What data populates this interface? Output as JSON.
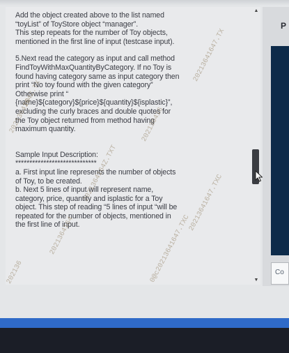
{
  "content": {
    "lines": [
      "Add the object created above to the list named",
      "“toyList” of ToyStore object “manager”.",
      "This step repeats for the number of Toy objects,",
      "mentioned in the first line of input (testcase input).",
      "5.Next read the category as input and call method",
      "FindToyWithMaxQuantityByCategory. If no Toy is",
      "found having category same as input category then",
      "print “No toy found with the given category”",
      "Otherwise print “",
      "{name}${category}${price}${quantity}${isplastic}”,",
      "excluding the curly braces and double quotes for",
      "the Toy object returned from method having",
      "maximum quantity.",
      "Sample Input Description:",
      "*****************************",
      "a. First input line represents the number of objects",
      "of Toy, to be created.",
      "b. Next 5 lines of input will represent name,",
      "category, price, quantity and isplastic for a Toy",
      "object. This step of reading “5 lines of input “will be",
      "repeated for the number of objects, mentioned in",
      "the first line of input."
    ]
  },
  "watermarks": [
    "2021364164Z.TX",
    "20213641647.TX",
    "2021364164Z.TXT",
    "20213641647.TXC",
    "202136416",
    "0@c20213641647.TXC",
    "202136",
    "2021364164",
    "20"
  ],
  "right_panel": {
    "label": "P",
    "input_value": "Co"
  },
  "colors": {
    "text": "#3a3c44",
    "pane_background": "#e9eaec",
    "dark_column": "#0d2b4a",
    "taskbar": "#2f6ac8",
    "scroll_thumb": "#3b3d42"
  },
  "icons": {
    "scroll_up": "triangle-up",
    "scroll_down": "triangle-down",
    "cursor": "mouse-pointer"
  }
}
